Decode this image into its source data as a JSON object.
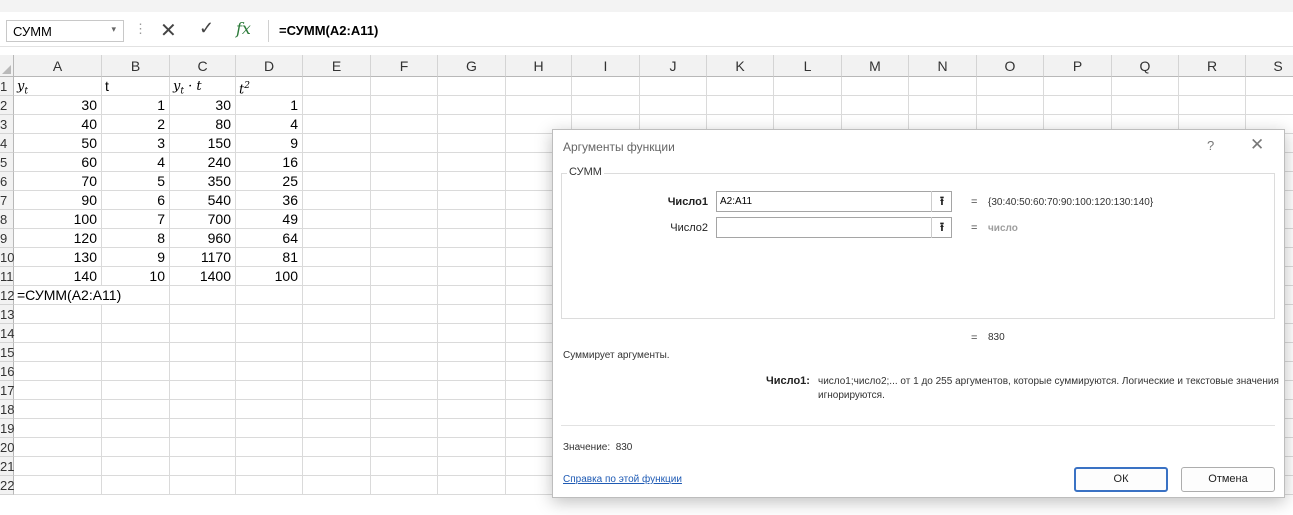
{
  "formula_bar": {
    "name_box": "СУММ",
    "name_box_arrow": "▾",
    "separator": "⋮",
    "cancel_icon": "✕",
    "enter_icon": "✓",
    "fx_label": "fx",
    "formula": "=СУММ(A2:A11)"
  },
  "grid": {
    "columns": [
      "A",
      "B",
      "C",
      "D",
      "E",
      "F",
      "G",
      "H",
      "I",
      "J",
      "K",
      "L",
      "M",
      "N",
      "O",
      "P",
      "Q",
      "R",
      "S"
    ],
    "rows": [
      "1",
      "2",
      "3",
      "4",
      "5",
      "6",
      "7",
      "8",
      "9",
      "10",
      "11",
      "12",
      "13",
      "14",
      "15",
      "16",
      "17",
      "18",
      "19",
      "20",
      "21",
      "22"
    ],
    "header_row": {
      "a_base": "y",
      "a_sub": "t",
      "b": "t",
      "c_base": "y",
      "c_sub": "t",
      "c_tail": " · t",
      "d_base": "t",
      "d_sup": "2"
    },
    "data": [
      [
        "30",
        "1",
        "30",
        "1"
      ],
      [
        "40",
        "2",
        "80",
        "4"
      ],
      [
        "50",
        "3",
        "150",
        "9"
      ],
      [
        "60",
        "4",
        "240",
        "16"
      ],
      [
        "70",
        "5",
        "350",
        "25"
      ],
      [
        "90",
        "6",
        "540",
        "36"
      ],
      [
        "100",
        "7",
        "700",
        "49"
      ],
      [
        "120",
        "8",
        "960",
        "64"
      ],
      [
        "130",
        "9",
        "1170",
        "81"
      ],
      [
        "140",
        "10",
        "1400",
        "100"
      ]
    ],
    "edit_cell": "=СУММ(A2:A11)"
  },
  "dialog": {
    "title": "Аргументы функции",
    "help_icon": "?",
    "close_icon": "✕",
    "function_name": "СУММ",
    "arg1_label": "Число1",
    "arg1_value": "A2:A11",
    "arg1_result": "{30:40:50:60:70:90:100:120:130:140}",
    "arg2_label": "Число2",
    "arg2_value": "",
    "arg2_result": "число",
    "ref_icon": "⭱",
    "eq_sign": "=",
    "formula_result": "830",
    "description": "Суммирует аргументы.",
    "detail_label": "Число1:",
    "detail_text": "число1;число2;... от 1 до 255 аргументов, которые суммируются. Логические и текстовые значения игнорируются.",
    "value_label": "Значение:",
    "value": "830",
    "help_link": "Справка по этой функции",
    "ok_label": "ОК",
    "cancel_label": "Отмена"
  }
}
